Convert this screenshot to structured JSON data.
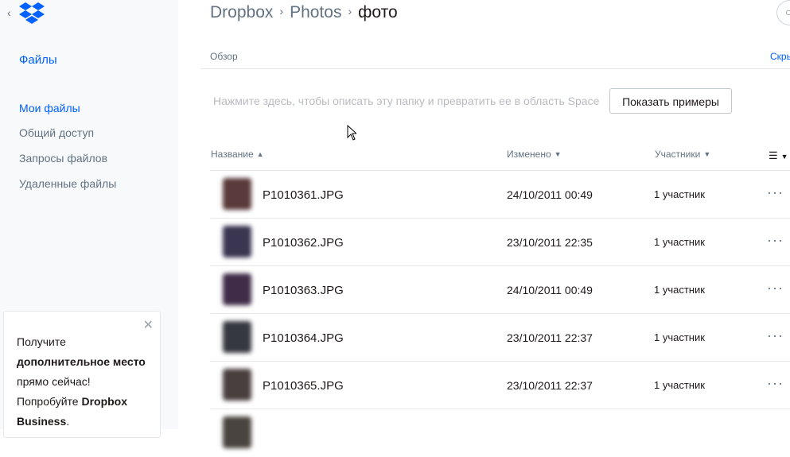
{
  "sidebar": {
    "back_icon": "chevron-left-icon",
    "logo_icon": "dropbox-logo-icon",
    "title": "Файлы",
    "items": [
      {
        "label": "Мои файлы",
        "active": true
      },
      {
        "label": "Общий доступ",
        "active": false
      },
      {
        "label": "Запросы файлов",
        "active": false
      },
      {
        "label": "Удаленные файлы",
        "active": false
      }
    ],
    "promo": {
      "line1": "Получите",
      "line2": "дополнительное место",
      "line3": "прямо сейчас!",
      "line4_prefix": "Попробуйте ",
      "line4_bold": "Dropbox",
      "line5_bold": "Business",
      "line5_suffix": ".",
      "close_icon": "close-icon"
    }
  },
  "breadcrumb": {
    "items": [
      "Dropbox",
      "Photos"
    ],
    "current": "фото",
    "separator": "›"
  },
  "header": {
    "overview_label": "Обзор",
    "hide_label": "Скры",
    "description_placeholder": "Нажмите здесь, чтобы описать эту папку и превратить ее в область Space",
    "examples_button": "Показать примеры"
  },
  "table": {
    "columns": {
      "name": "Название",
      "modified": "Изменено",
      "members": "Участники"
    },
    "rows": [
      {
        "name": "P1010361.JPG",
        "modified": "24/10/2011 00:49",
        "members": "1 участник",
        "thumb_color": "#5a3a3a"
      },
      {
        "name": "P1010362.JPG",
        "modified": "23/10/2011 22:35",
        "members": "1 участник",
        "thumb_color": "#3a3550"
      },
      {
        "name": "P1010363.JPG",
        "modified": "24/10/2011 00:49",
        "members": "1 участник",
        "thumb_color": "#402c48"
      },
      {
        "name": "P1010364.JPG",
        "modified": "23/10/2011 22:37",
        "members": "1 участник",
        "thumb_color": "#35383f"
      },
      {
        "name": "P1010365.JPG",
        "modified": "23/10/2011 22:37",
        "members": "1 участник",
        "thumb_color": "#4a3f3f"
      }
    ],
    "more_label": "···"
  },
  "colors": {
    "accent": "#0061fe",
    "muted": "#637282",
    "sidebar_bg": "#f7f9fa"
  }
}
